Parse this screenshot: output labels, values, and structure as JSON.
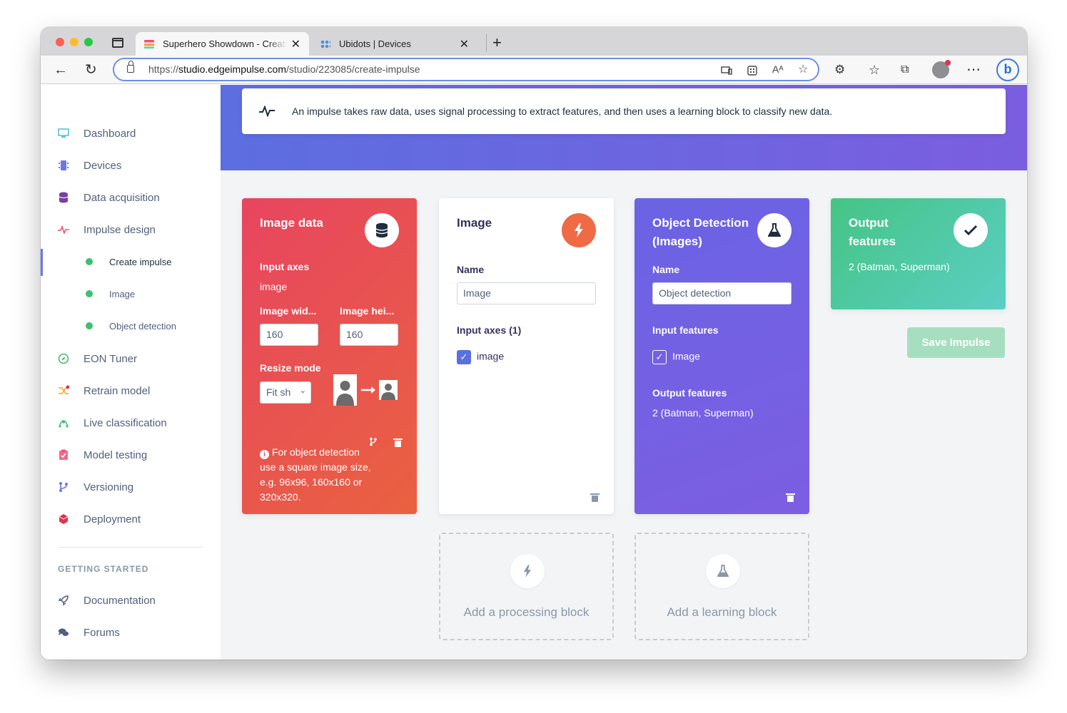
{
  "browser": {
    "tabs": [
      {
        "title": "Superhero Showdown - Create impulse"
      },
      {
        "title": "Ubidots | Devices"
      }
    ],
    "url_scheme": "https://",
    "url_host": "studio.edgeimpulse.com",
    "url_path": "/studio/223085/create-impulse",
    "reader_label": "Aᴬ"
  },
  "sidebar": {
    "items": [
      {
        "label": "Dashboard",
        "icon": "monitor-icon",
        "color": "#5bc0de"
      },
      {
        "label": "Devices",
        "icon": "chip-icon",
        "color": "#6a76f0"
      },
      {
        "label": "Data acquisition",
        "icon": "database-icon",
        "color": "#7b3fa0"
      },
      {
        "label": "Impulse design",
        "icon": "pulse-icon",
        "color": "#f0506e"
      },
      {
        "label": "EON Tuner",
        "icon": "compass-icon",
        "color": "#3bc26c"
      },
      {
        "label": "Retrain model",
        "icon": "shuffle-icon",
        "color": "#f5a623"
      },
      {
        "label": "Live classification",
        "icon": "live-icon",
        "color": "#3bc26c"
      },
      {
        "label": "Model testing",
        "icon": "clipboard-check-icon",
        "color": "#f0506e"
      },
      {
        "label": "Versioning",
        "icon": "branch-icon",
        "color": "#6a76f0"
      },
      {
        "label": "Deployment",
        "icon": "cube-icon",
        "color": "#e0344d"
      }
    ],
    "subitems": [
      {
        "label": "Create impulse"
      },
      {
        "label": "Image"
      },
      {
        "label": "Object detection"
      }
    ],
    "getting_started_heading": "GETTING STARTED",
    "getting_started": [
      {
        "label": "Documentation",
        "icon": "rocket-icon"
      },
      {
        "label": "Forums",
        "icon": "chat-icon"
      }
    ]
  },
  "banner": {
    "text": "An impulse takes raw data, uses signal processing to extract features, and then uses a learning block to classify new data."
  },
  "image_data": {
    "title": "Image data",
    "input_axes_label": "Input axes",
    "input_axes_value": "image",
    "width_label": "Image wid...",
    "height_label": "Image hei...",
    "width_value": "160",
    "height_value": "160",
    "resize_label": "Resize mode",
    "resize_value": "Fit sh",
    "note_line1": "For object detection",
    "note_rest": "use a square image size, e.g. 96x96, 160x160 or 320x320."
  },
  "processing_block": {
    "title": "Image",
    "name_label": "Name",
    "name_value": "Image",
    "input_axes_label": "Input axes (1)",
    "axis_option": "image"
  },
  "learning_block": {
    "title": "Object Detection (Images)",
    "name_label": "Name",
    "name_value": "Object detection",
    "input_features_label": "Input features",
    "input_feature": "Image",
    "output_features_label": "Output features",
    "output_features_value": "2 (Batman, Superman)"
  },
  "output_block": {
    "title": "Output features",
    "value": "2 (Batman, Superman)"
  },
  "actions": {
    "save": "Save Impulse",
    "add_processing": "Add a processing block",
    "add_learning": "Add a learning block"
  },
  "colors": {
    "accent": "#6a76f0",
    "image_data_gradient_start": "#e84560",
    "image_data_gradient_end": "#e96140",
    "learning_block": "#7163e3",
    "output_block": "#45c485",
    "save_button": "#a6dfbf"
  }
}
